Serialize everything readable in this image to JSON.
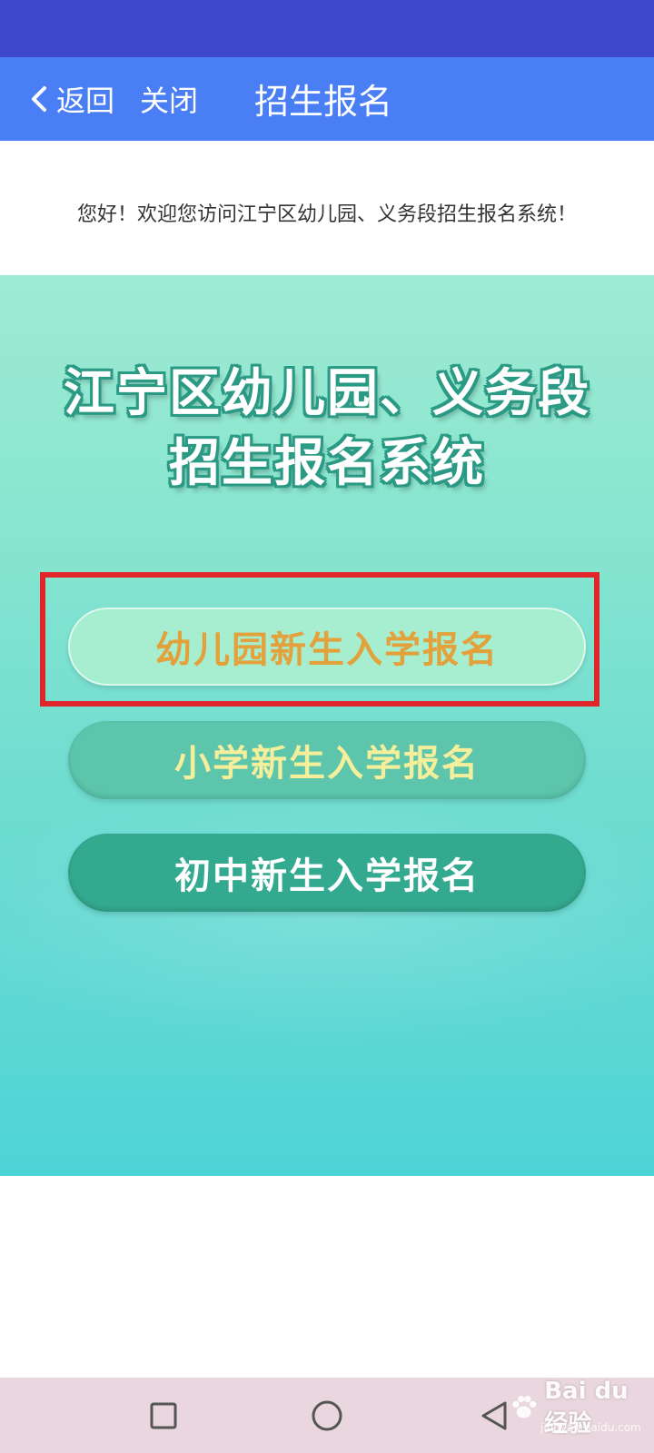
{
  "header": {
    "back_label": "返回",
    "close_label": "关闭",
    "title": "招生报名"
  },
  "welcome_text": "您好！欢迎您访问江宁区幼儿园、义务段招生报名系统！",
  "banner": {
    "title_line1": "江宁区幼儿园、义务段",
    "title_line2": "招生报名系统"
  },
  "options": [
    {
      "label": "幼儿园新生入学报名",
      "highlighted": true
    },
    {
      "label": "小学新生入学报名",
      "highlighted": false
    },
    {
      "label": "初中新生入学报名",
      "highlighted": false
    }
  ],
  "nav": {
    "icons": [
      "recent-apps-icon",
      "home-icon",
      "back-icon"
    ]
  },
  "watermark": {
    "logo_text": "Bai du 经验",
    "url_text": "jingyan.baidu.com"
  },
  "colors": {
    "status_bar": "#3f48cc",
    "header": "#4a7ef5",
    "highlight": "#e0262b",
    "nav_bar": "#ead6de"
  }
}
